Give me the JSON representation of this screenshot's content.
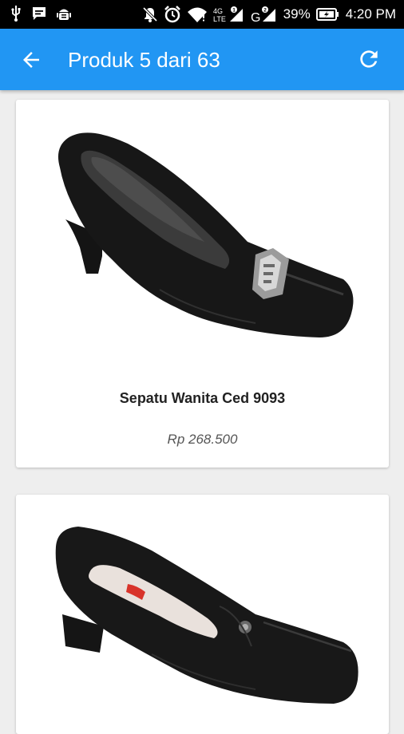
{
  "status_bar": {
    "network_label": "4G LTE",
    "battery_percent": "39%",
    "time": "4:20 PM"
  },
  "app_bar": {
    "title": "Produk 5 dari 63",
    "color": "#2196f3"
  },
  "products": [
    {
      "name": "Sepatu Wanita Ced 9093",
      "price": "Rp 268.500",
      "image_icon": "black-pump-shoe-with-buckle"
    },
    {
      "image_icon": "black-pump-shoe-with-button"
    }
  ]
}
